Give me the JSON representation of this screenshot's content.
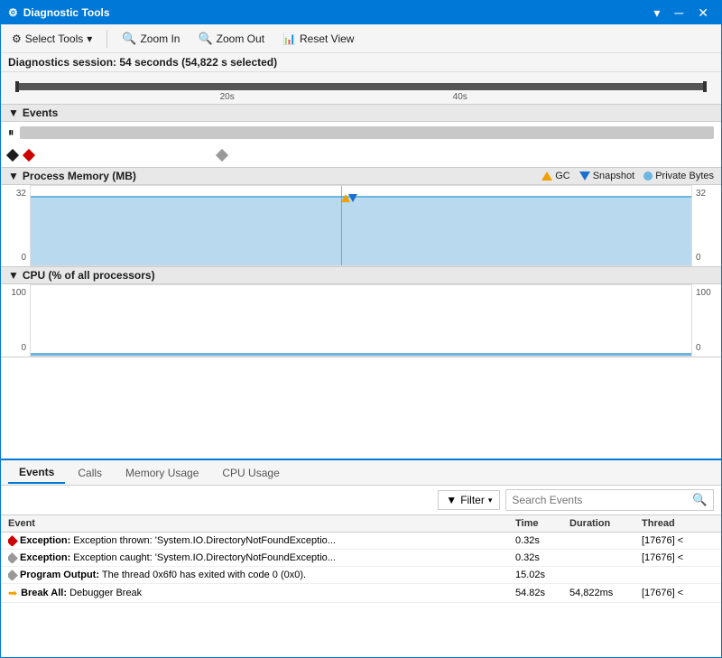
{
  "window": {
    "title": "Diagnostic Tools"
  },
  "toolbar": {
    "select_tools": "Select Tools",
    "zoom_in": "Zoom In",
    "zoom_out": "Zoom Out",
    "reset_view": "Reset View"
  },
  "session": {
    "label": "Diagnostics session: 54 seconds (54,822 s selected)"
  },
  "timeline": {
    "label_20": "20s",
    "label_40": "40s"
  },
  "sections": {
    "events": "Events",
    "memory": "Process Memory (MB)",
    "cpu": "CPU (% of all processors)"
  },
  "memory_legend": {
    "gc": "GC",
    "snapshot": "Snapshot",
    "private_bytes": "Private Bytes"
  },
  "memory_chart": {
    "y_top": "32",
    "y_bottom": "0",
    "y_right_top": "32",
    "y_right_bottom": "0"
  },
  "cpu_chart": {
    "y_top": "100",
    "y_bottom": "0",
    "y_right_top": "100",
    "y_right_bottom": "0"
  },
  "tabs": [
    {
      "label": "Events",
      "active": true
    },
    {
      "label": "Calls",
      "active": false
    },
    {
      "label": "Memory Usage",
      "active": false
    },
    {
      "label": "CPU Usage",
      "active": false
    }
  ],
  "filter_btn": "Filter",
  "search_placeholder": "Search Events",
  "table_headers": {
    "event": "Event",
    "time": "Time",
    "duration": "Duration",
    "thread": "Thread"
  },
  "events": [
    {
      "icon": "red-diamond",
      "label": "Exception:",
      "text": "Exception thrown: 'System.IO.DirectoryNotFoundExceptio...",
      "time": "0.32s",
      "duration": "",
      "thread": "[17676] <"
    },
    {
      "icon": "gray-diamond",
      "label": "Exception:",
      "text": "Exception caught: 'System.IO.DirectoryNotFoundExceptio...",
      "time": "0.32s",
      "duration": "",
      "thread": "[17676] <"
    },
    {
      "icon": "gray-diamond",
      "label": "Program Output:",
      "text": "The thread 0x6f0 has exited with code 0 (0x0).",
      "time": "15.02s",
      "duration": "",
      "thread": ""
    },
    {
      "icon": "yellow-arrow",
      "label": "Break All:",
      "text": "Debugger Break",
      "time": "54.82s",
      "duration": "54,822ms",
      "thread": "[17676] <"
    }
  ]
}
